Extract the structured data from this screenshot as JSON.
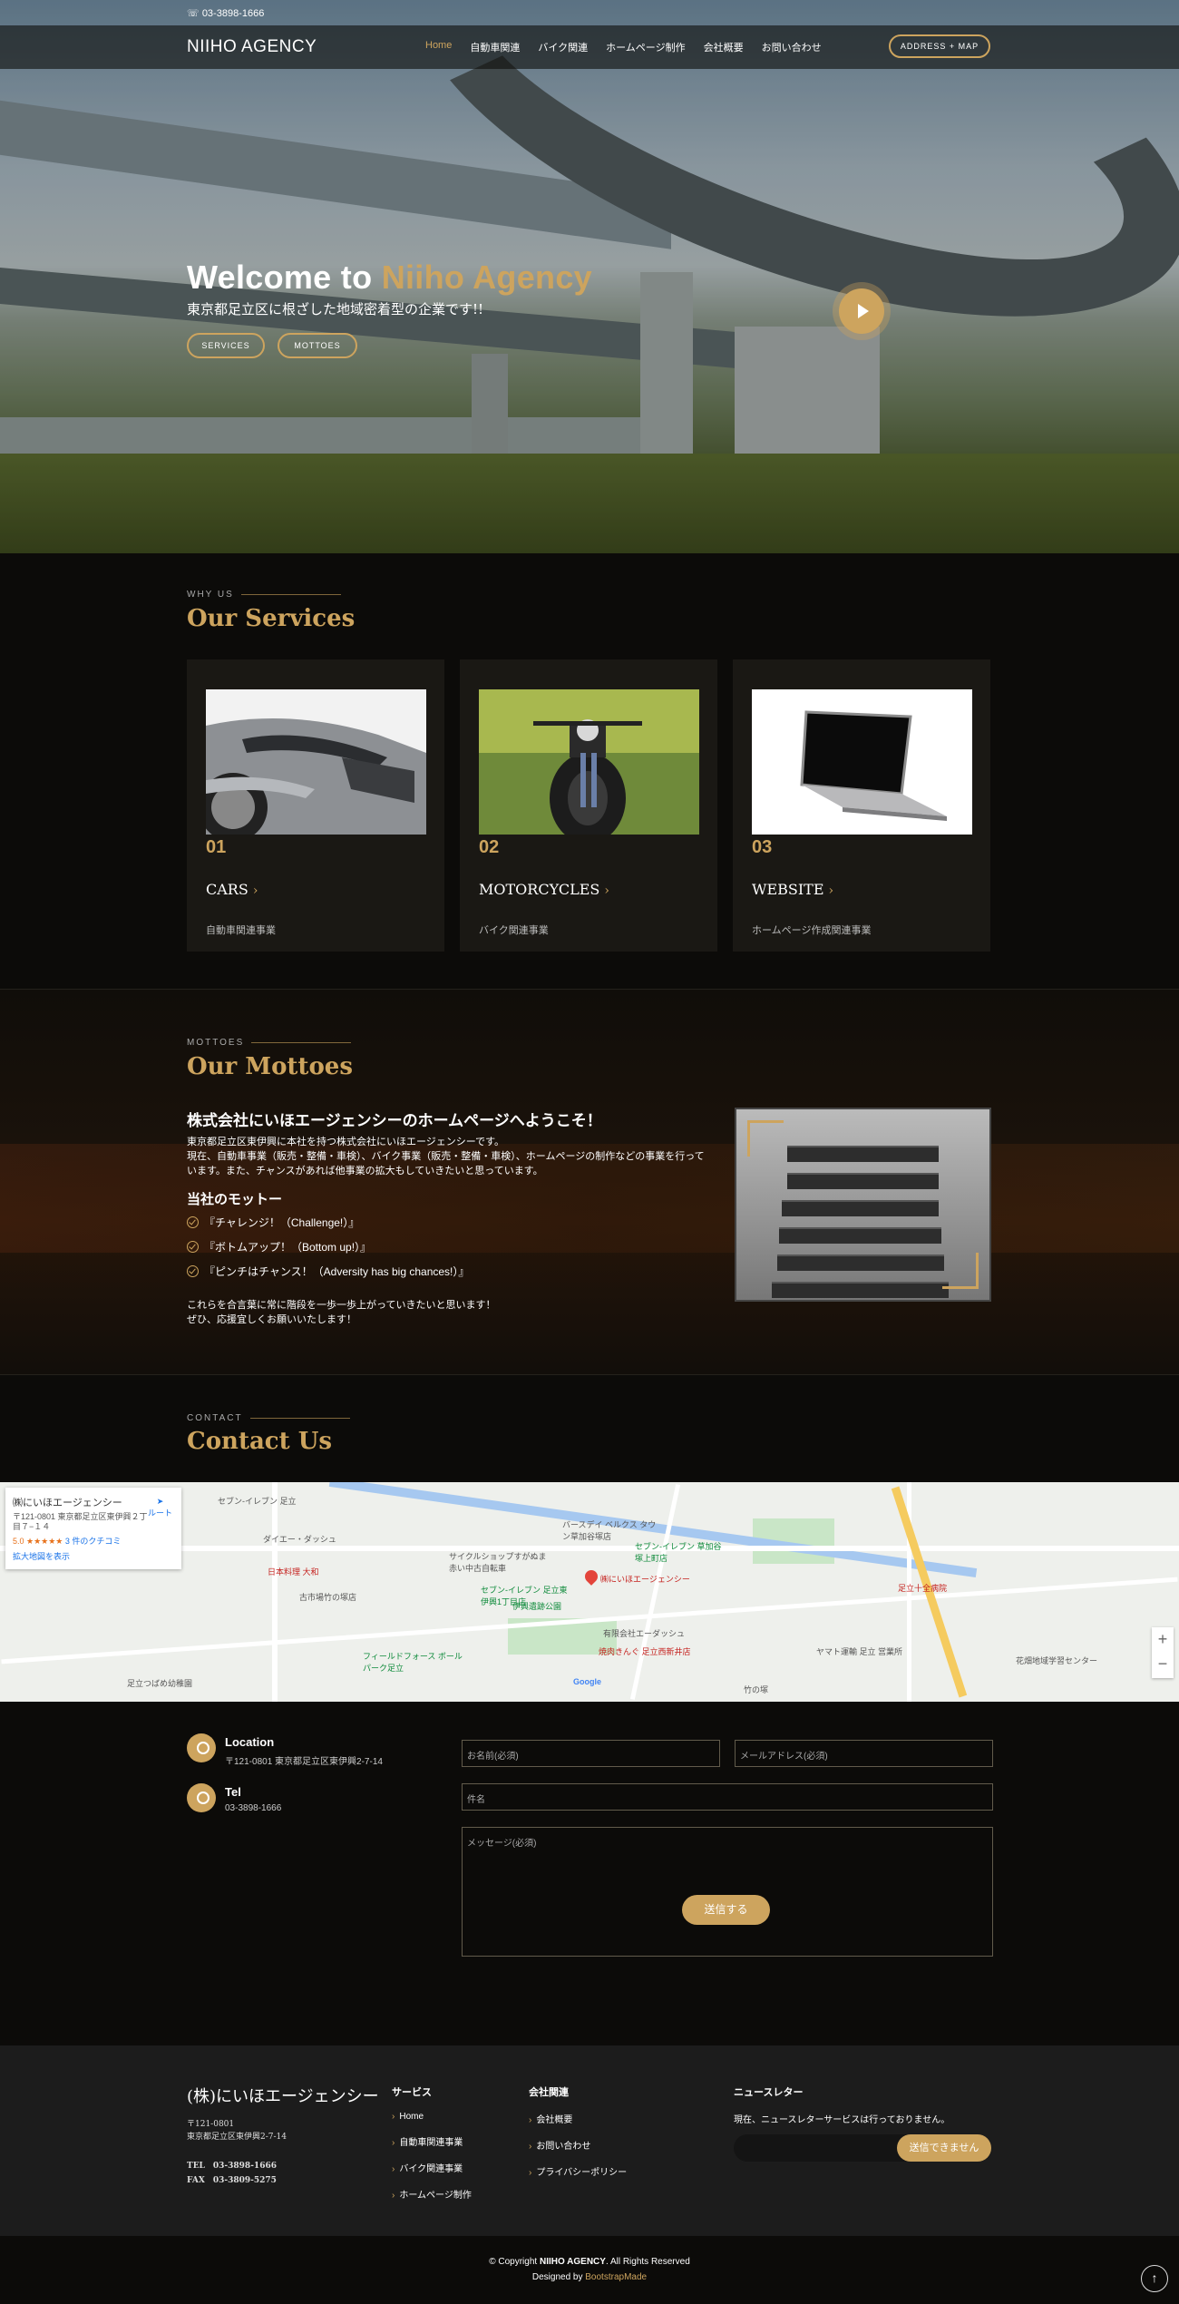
{
  "topbar": {
    "phone": "03-3898-1666"
  },
  "header": {
    "logo": "NIIHO AGENCY",
    "nav": [
      "Home",
      "自動車関連",
      "バイク関連",
      "ホームページ制作",
      "会社概要",
      "お問い合わせ"
    ],
    "cta": "ADDRESS + MAP"
  },
  "hero": {
    "title_prefix": "Welcome to ",
    "title_highlight": "Niiho Agency",
    "subtitle": "東京都足立区に根ざした地域密着型の企業です!!",
    "btn_services": "SERVICES",
    "btn_mottoes": "MOTTOES"
  },
  "services": {
    "eyebrow": "WHY US",
    "title": "Our Services",
    "cards": [
      {
        "num": "01",
        "title": "CARS",
        "desc": "自動車関連事業"
      },
      {
        "num": "02",
        "title": "MOTORCYCLES",
        "desc": "バイク関連事業"
      },
      {
        "num": "03",
        "title": "WEBSITE",
        "desc": "ホームページ作成関連事業"
      }
    ]
  },
  "mottoes": {
    "eyebrow": "MOTTOES",
    "title": "Our Mottoes",
    "heading": "株式会社にいほエージェンシーのホームページへようこそ！",
    "intro1": "東京都足立区東伊興に本社を持つ株式会社にいほエージェンシーです。",
    "intro2": "現在、自動車事業（販売・整備・車検）、バイク事業（販売・整備・車検）、ホームページの制作などの事業を行って",
    "intro3": "います。また、チャンスがあれば他事業の拡大もしていきたいと思っています。",
    "motto_heading": "当社のモットー",
    "items": [
      "『チャレンジ！（Challenge!）』",
      "『ボトムアップ！（Bottom up!）』",
      "『ピンチはチャンス！（Adversity has big chances!）』"
    ],
    "closing1": "これらを合言葉に常に階段を一歩一歩上がっていきたいと思います！",
    "closing2": "ぜひ、応援宜しくお願いいたします！"
  },
  "contact": {
    "eyebrow": "CONTACT",
    "title": "Contact Us",
    "map": {
      "place": "㈱にいほエージェンシー",
      "address": "〒121-0801 東京都足立区東伊興２丁目７−１４",
      "rating": "5.0 ★★★★★",
      "reviews": "3 件のクチコミ",
      "larger": "拡大地図を表示",
      "directions": "ルート",
      "pin_label": "㈱にいほエージェンシー",
      "labels": [
        "セブン-イレブン 足立",
        "バースデイ ベルクス タウン草加谷塚店",
        "ダイエー・ダッシュ",
        "サイクルショップすがぬま 赤い中古自転車",
        "セブン-イレブン 草加谷塚上町店",
        "日本料理 大和",
        "セブン-イレブン 足立東伊興1丁目店",
        "伊興遺跡公園",
        "古市場竹の塚店",
        "足立十全病院",
        "フィールドフォース ボールパーク足立",
        "有限会社エーダッシュ",
        "ヤマト運輸 足立 営業所",
        "焼肉きんぐ 足立西新井店",
        "花畑地域学習センター",
        "足立つばめ幼稚園",
        "竹の塚",
        "Google"
      ],
      "zoom_in": "+",
      "zoom_out": "−"
    },
    "location_title": "Location",
    "location_value": "〒121-0801 東京都足立区東伊興2-7-14",
    "tel_title": "Tel",
    "tel_value": "03-3898-1666",
    "form": {
      "name": "お名前(必須)",
      "email": "メールアドレス(必須)",
      "subject": "件名",
      "message": "メッセージ(必須)",
      "send": "送信する"
    }
  },
  "footer": {
    "brand": "(株)にいほエージェンシー",
    "zip": "〒121-0801",
    "address": "東京都足立区東伊興2-7-14",
    "tel": "TEL　03-3898-1666",
    "fax": "FAX　03-3809-5275",
    "services_title": "サービス",
    "services": [
      "Home",
      "自動車関連事業",
      "バイク関連事業",
      "ホームページ制作"
    ],
    "company_title": "会社関連",
    "company": [
      "会社概要",
      "お問い合わせ",
      "プライバシーポリシー"
    ],
    "news_title": "ニュースレター",
    "news_text": "現在、ニュースレターサービスは行っておりません。",
    "news_btn": "送信できません",
    "copyright_pre": "© Copyright ",
    "copyright_brand": "NIIHO AGENCY",
    "copyright_post": ". All Rights Reserved",
    "designed_pre": "Designed by ",
    "designed_brand": "BootstrapMade"
  },
  "colors": {
    "accent": "#cda45e",
    "background": "#0c0b09"
  }
}
